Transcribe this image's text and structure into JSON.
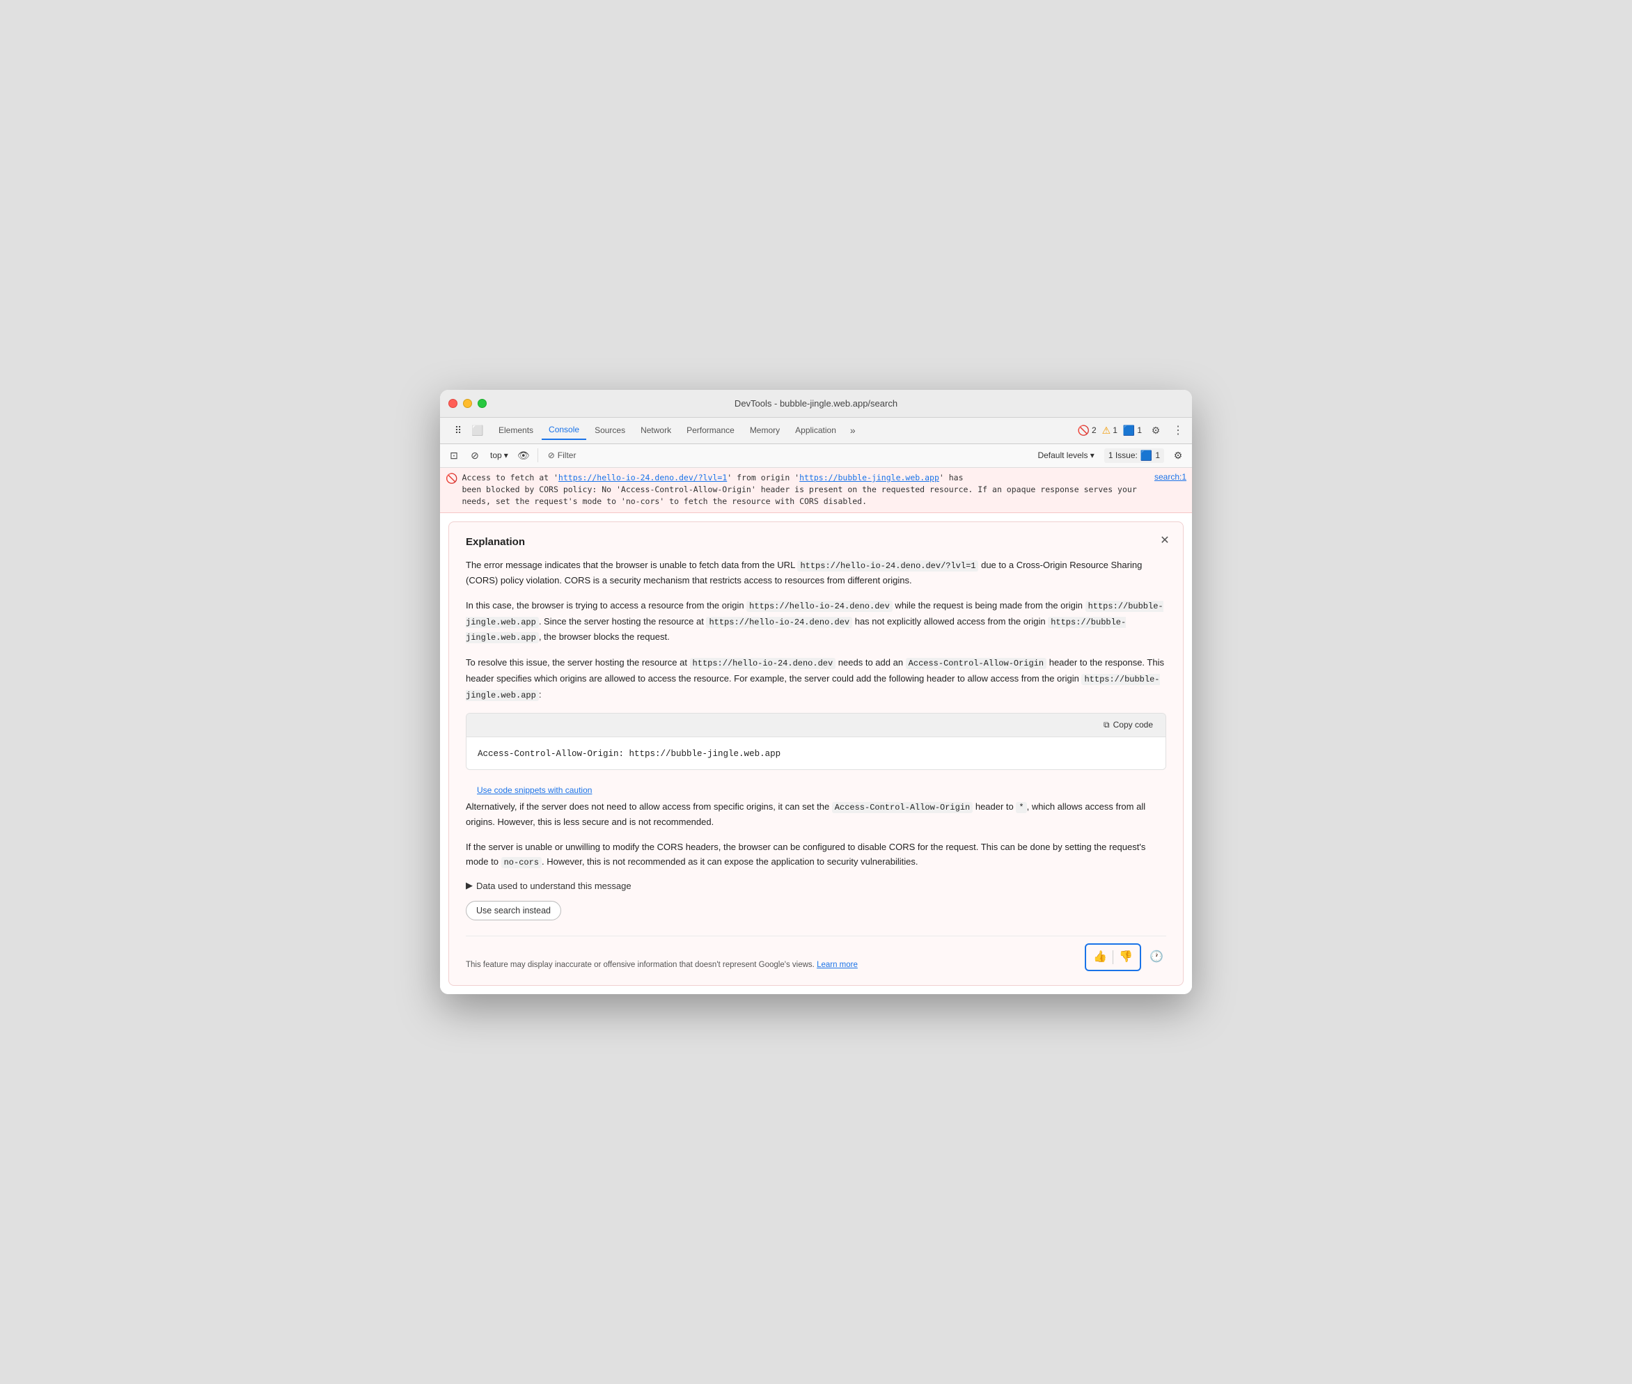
{
  "window": {
    "title": "DevTools - bubble-jingle.web.app/search"
  },
  "tabs": {
    "items": [
      {
        "label": "Elements",
        "active": false
      },
      {
        "label": "Console",
        "active": true
      },
      {
        "label": "Sources",
        "active": false
      },
      {
        "label": "Network",
        "active": false
      },
      {
        "label": "Performance",
        "active": false
      },
      {
        "label": "Memory",
        "active": false
      },
      {
        "label": "Application",
        "active": false
      }
    ],
    "more": "»",
    "error_count": "2",
    "warning_count": "1",
    "issue_count": "1",
    "issue_label": "1 Issue:",
    "settings_icon": "⚙",
    "more_icon": "⋮"
  },
  "toolbar": {
    "inspect_icon": "⊡",
    "device_icon": "⬜",
    "top_label": "top",
    "eye_icon": "👁",
    "filter_icon": "⊘",
    "filter_label": "Filter",
    "default_levels_label": "Default levels ▾",
    "settings_icon": "⚙"
  },
  "error_message": {
    "text_before": "Access to fetch at '",
    "url1": "https://hello-io-24.deno.dev/?lvl=1",
    "text_middle1": "' from origin '",
    "url2": "https://bubble-jingle.web.app",
    "text_after": "' has",
    "continuation": "been blocked by CORS policy: No 'Access-Control-Allow-Origin' header is present on the requested resource. If an opaque response serves your needs, set the request's mode to 'no-cors' to fetch the resource with CORS disabled.",
    "source": "search:1"
  },
  "explanation": {
    "title": "Explanation",
    "close_icon": "✕",
    "paragraphs": [
      "The error message indicates that the browser is unable to fetch data from the URL https://hello-io-24.deno.dev/?lvl=1 due to a Cross-Origin Resource Sharing (CORS) policy violation. CORS is a security mechanism that restricts access to resources from different origins.",
      "In this case, the browser is trying to access a resource from the origin https://hello-io-24.deno.dev while the request is being made from the origin https://bubble-jingle.web.app. Since the server hosting the resource at https://hello-io-24.deno.dev has not explicitly allowed access from the origin https://bubble-jingle.web.app, the browser blocks the request.",
      "To resolve this issue, the server hosting the resource at https://hello-io-24.deno.dev needs to add an Access-Control-Allow-Origin header to the response. This header specifies which origins are allowed to access the resource. For example, the server could add the following header to allow access from the origin https://bubble-jingle.web.app:"
    ],
    "code_snippet": "Access-Control-Allow-Origin: https://bubble-jingle.web.app",
    "copy_code_label": "Copy code",
    "copy_icon": "⧉",
    "caution_link": "Use code snippets with caution",
    "paragraph_after_code": "Alternatively, if the server does not need to allow access from specific origins, it can set the Access-Control-Allow-Origin header to *, which allows access from all origins. However, this is less secure and is not recommended.",
    "paragraph_last": "If the server is unable or unwilling to modify the CORS headers, the browser can be configured to disable CORS for the request. This can be done by setting the request's mode to no-cors. However, this is not recommended as it can expose the application to security vulnerabilities.",
    "data_toggle_label": "▶ Data used to understand this message",
    "use_search_label": "Use search instead",
    "disclaimer": "This feature may display inaccurate or offensive information that doesn't represent Google's views.",
    "learn_more_label": "Learn more",
    "thumbs_up_icon": "👍",
    "thumbs_down_icon": "👎",
    "info_icon": "🕐"
  }
}
